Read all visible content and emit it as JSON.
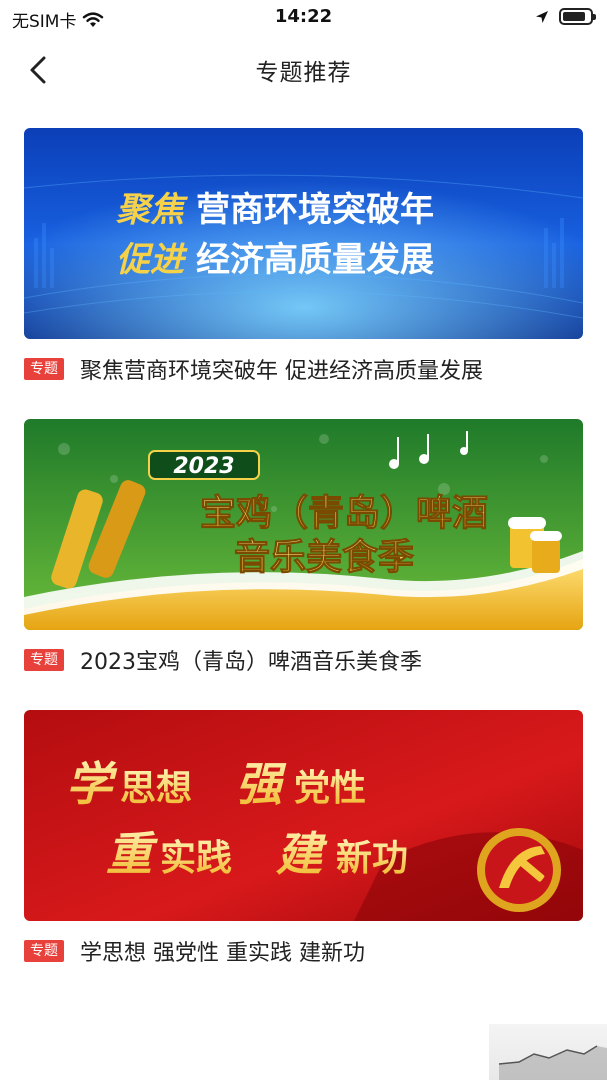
{
  "status_bar": {
    "carrier": "无SIM卡",
    "time": "14:22",
    "battery_level": 0.85,
    "icons": [
      "wifi-icon",
      "location-arrow-icon",
      "battery-icon"
    ]
  },
  "nav": {
    "title": "专题推荐",
    "back_icon": "chevron-left-icon"
  },
  "topics": [
    {
      "tag": "专题",
      "title": "聚焦营商环境突破年 促进经济高质量发展",
      "banner": {
        "line1_prefix": "聚焦",
        "line1_main": "营商环境突破年",
        "line2_prefix": "促进",
        "line2_main": "经济高质量发展",
        "theme": "blue-tech"
      }
    },
    {
      "tag": "专题",
      "title": "2023宝鸡（青岛）啤酒音乐美食季",
      "banner": {
        "year": "2023",
        "line1": "宝鸡（青岛）啤酒",
        "line2": "音乐美食季",
        "theme": "green-beer"
      }
    },
    {
      "tag": "专题",
      "title": "学思想 强党性 重实践 建新功",
      "banner": {
        "line1_a": "学",
        "line1_b": "思想",
        "line1_c": "强",
        "line1_d": "党性",
        "line2_a": "重",
        "line2_b": "实践",
        "line2_c": "建",
        "line2_d": "新功",
        "theme": "red-party"
      }
    }
  ],
  "colors": {
    "tag_red": "#e8413b",
    "gold": "#f5c542"
  }
}
